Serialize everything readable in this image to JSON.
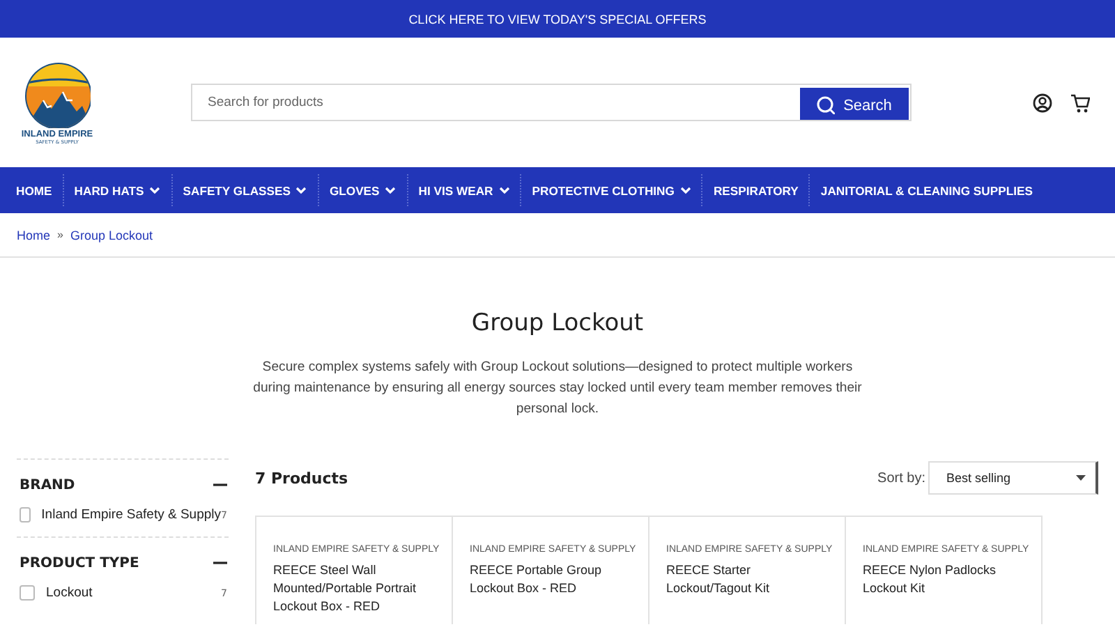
{
  "announcement": "CLICK HERE TO VIEW TODAY'S SPECIAL OFFERS",
  "logo": {
    "name": "INLAND EMPIRE",
    "tagline": "SAFETY & SUPPLY"
  },
  "search": {
    "placeholder": "Search for products",
    "button": "Search"
  },
  "nav": [
    {
      "label": "HOME",
      "dropdown": false
    },
    {
      "label": "HARD HATS",
      "dropdown": true
    },
    {
      "label": "SAFETY GLASSES",
      "dropdown": true
    },
    {
      "label": "GLOVES",
      "dropdown": true
    },
    {
      "label": "HI VIS WEAR",
      "dropdown": true
    },
    {
      "label": "PROTECTIVE CLOTHING",
      "dropdown": true
    },
    {
      "label": "RESPIRATORY",
      "dropdown": false
    },
    {
      "label": "JANITORIAL & CLEANING SUPPLIES",
      "dropdown": false
    }
  ],
  "breadcrumb": [
    "Home",
    "Group Lockout"
  ],
  "breadcrumb_separator": "»",
  "title": "Group Lockout",
  "description": "Secure complex systems safely with Group Lockout solutions—designed to protect multiple workers during maintenance by ensuring all energy sources stay locked until every team member removes their personal lock.",
  "filters": [
    {
      "heading": "BRAND",
      "expanded": true,
      "options": [
        {
          "label": "Inland Empire Safety & Supply",
          "count": "7",
          "checked": false
        }
      ]
    },
    {
      "heading": "PRODUCT TYPE",
      "expanded": true,
      "options": [
        {
          "label": "Lockout",
          "count": "7",
          "checked": false
        }
      ]
    }
  ],
  "product_count": "7 Products",
  "sort": {
    "label": "Sort by:",
    "value": "Best selling"
  },
  "products": [
    {
      "vendor": "INLAND EMPIRE SAFETY & SUPPLY",
      "title": "REECE Steel Wall Mounted/Portable Portrait Lockout Box - RED"
    },
    {
      "vendor": "INLAND EMPIRE SAFETY & SUPPLY",
      "title": "REECE Portable Group Lockout Box - RED"
    },
    {
      "vendor": "INLAND EMPIRE SAFETY & SUPPLY",
      "title": "REECE Starter Lockout/Tagout Kit"
    },
    {
      "vendor": "INLAND EMPIRE SAFETY & SUPPLY",
      "title": "REECE Nylon Padlocks Lockout Kit"
    }
  ]
}
